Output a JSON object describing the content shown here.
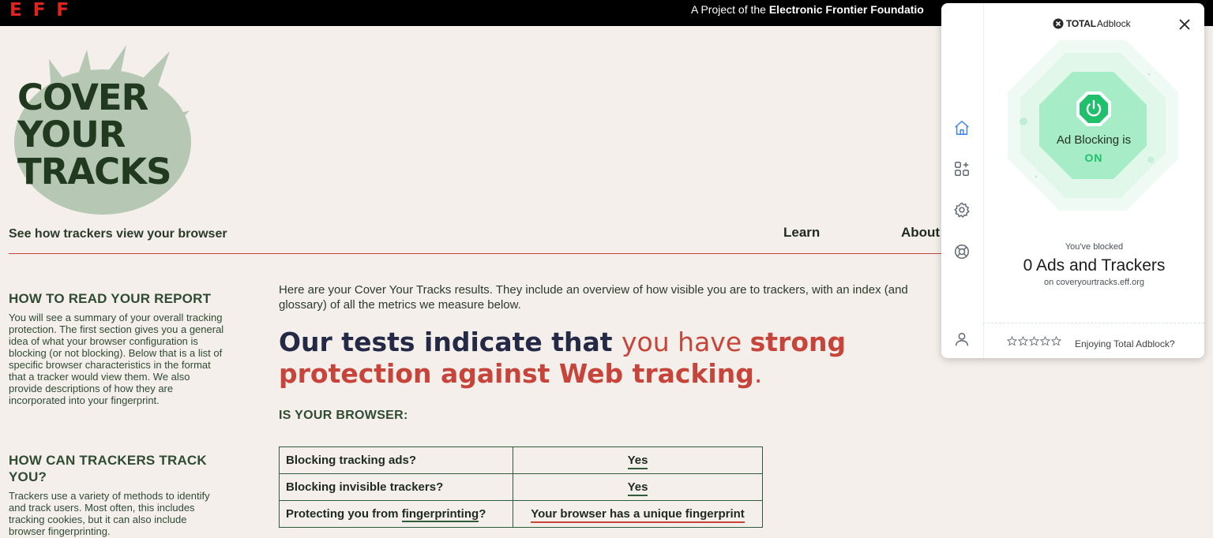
{
  "topbar": {
    "logo_text": "EFF",
    "project_prefix": "A Project of the ",
    "project_org": "Electronic Frontier Foundatio"
  },
  "logo": {
    "line1": "COVER",
    "line2": "YOUR",
    "line3": "TRACKS"
  },
  "tagline": "See how trackers view your browser",
  "nav": {
    "learn": "Learn",
    "about": "About"
  },
  "sidebar": {
    "section1": {
      "title": "HOW TO READ YOUR REPORT",
      "body": "You will see a summary of your overall tracking protection. The first section gives you a general idea of what your browser configuration is blocking (or not blocking). Below that is a list of specific browser characteristics in the format that a tracker would view them. We also provide descriptions of how they are incorporated into your fingerprint."
    },
    "section2": {
      "title": "HOW CAN TRACKERS TRACK YOU?",
      "body": "Trackers use a variety of methods to identify and track users. Most often, this includes tracking cookies, but it can also include browser fingerprinting."
    }
  },
  "main": {
    "intro": "Here are your Cover Your Tracks results. They include an overview of how visible you are to trackers, with an index (and glossary) of all the metrics we measure below.",
    "headline_a": "Our tests indicate that ",
    "headline_b": "you have ",
    "headline_c": "strong protection against Web tracking",
    "headline_d": ".",
    "question_title": "IS YOUR BROWSER:",
    "rows": [
      {
        "question": "Blocking tracking ads?",
        "answer": "Yes"
      },
      {
        "question": "Blocking invisible trackers?",
        "answer": "Yes"
      },
      {
        "question_prefix": "Protecting you from ",
        "question_link": "fingerprinting",
        "question_suffix": "?",
        "answer": "Your browser has a unique fingerprint"
      }
    ]
  },
  "popup": {
    "brand_a": "TOTAL",
    "brand_b": "Adblock",
    "status_label": "Ad Blocking is",
    "status_value": "ON",
    "blocked_label": "You've blocked",
    "blocked_count": "0 Ads and Trackers",
    "blocked_site": "on coveryourtracks.eff.org",
    "footer_prompt": "Enjoying Total Adblock?",
    "rating_stars": 5,
    "rail_icons": [
      "home-icon",
      "apps-add-icon",
      "settings-icon",
      "support-icon",
      "account-icon"
    ],
    "colors": {
      "accent_green": "#1fbf6b",
      "active_blue": "#3b82f6"
    }
  }
}
